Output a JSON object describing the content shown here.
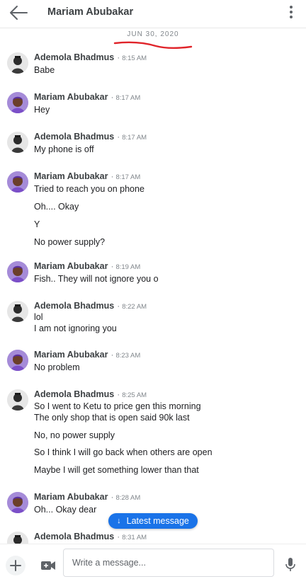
{
  "header": {
    "title": "Mariam Abubakar",
    "back_icon": "arrow-back-icon",
    "menu_icon": "more-vert-icon"
  },
  "date_separator": "JUN 30, 2020",
  "messages": [
    {
      "sender": "Ademola Bhadmus",
      "time": "8:15 AM",
      "lines": [
        "Babe"
      ]
    },
    {
      "sender": "Mariam Abubakar",
      "time": "8:17 AM",
      "lines": [
        "Hey"
      ]
    },
    {
      "sender": "Ademola Bhadmus",
      "time": "8:17 AM",
      "lines": [
        "My phone is off"
      ]
    },
    {
      "sender": "Mariam Abubakar",
      "time": "8:17 AM",
      "lines": [
        "Tried to reach you on phone",
        "Oh.... Okay",
        "Y",
        "No power supply?"
      ]
    },
    {
      "sender": "Mariam Abubakar",
      "time": "8:19 AM",
      "lines": [
        "Fish.. They will not ignore you o"
      ]
    },
    {
      "sender": "Ademola Bhadmus",
      "time": "8:22 AM",
      "lines": [
        "lol",
        "I am not ignoring you"
      ]
    },
    {
      "sender": "Mariam Abubakar",
      "time": "8:23 AM",
      "lines": [
        "No problem"
      ]
    },
    {
      "sender": "Ademola Bhadmus",
      "time": "8:25 AM",
      "lines": [
        "So I went to Ketu to price gen this morning",
        "The only shop that is open said 90k last",
        "No, no power supply",
        "So I think I will go back when others are open",
        "Maybe I will get something lower than that"
      ]
    },
    {
      "sender": "Mariam Abubakar",
      "time": "8:28 AM",
      "lines": [
        "Oh... Okay dear"
      ]
    },
    {
      "sender": "Ademola Bhadmus",
      "time": "8:31 AM",
      "lines": []
    }
  ],
  "latest_message_button": "Latest message",
  "composer": {
    "placeholder": "Write a message...",
    "add_icon": "plus-icon",
    "video_icon": "video-icon",
    "mic_icon": "mic-icon"
  },
  "colors": {
    "accent": "#1a73e8",
    "underline_mark": "#e0242a",
    "mariam_avatar": "#a58bd8"
  }
}
